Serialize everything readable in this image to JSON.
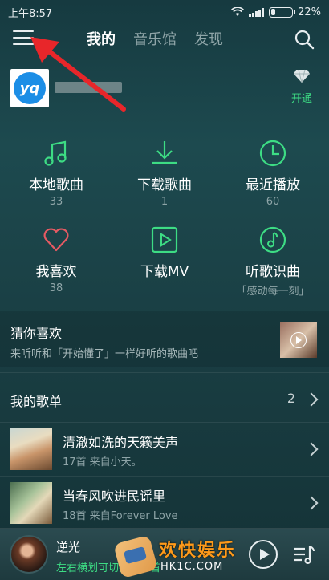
{
  "status_bar": {
    "time": "上午8:57",
    "battery": "22%",
    "battery_level": 0.22
  },
  "nav": {
    "tabs": [
      {
        "label": "我的",
        "active": true
      },
      {
        "label": "音乐馆",
        "active": false
      },
      {
        "label": "发现",
        "active": false
      }
    ]
  },
  "profile": {
    "avatar_text": "yq",
    "vip_label": "开通",
    "vip_icon": "diamond-icon"
  },
  "grid": [
    {
      "icon": "music-note-icon",
      "title": "本地歌曲",
      "sub": "33"
    },
    {
      "icon": "download-icon",
      "title": "下载歌曲",
      "sub": "1"
    },
    {
      "icon": "clock-icon",
      "title": "最近播放",
      "sub": "60"
    },
    {
      "icon": "heart-icon",
      "title": "我喜欢",
      "sub": "38"
    },
    {
      "icon": "video-play-icon",
      "title": "下载MV",
      "sub": ""
    },
    {
      "icon": "recognize-icon",
      "title": "听歌识曲",
      "sub": "「感动每一刻」"
    }
  ],
  "guess": {
    "title": "猜你喜欢",
    "subtitle": "来听听和「开始懂了」一样好听的歌曲吧"
  },
  "my_playlists": {
    "title": "我的歌单",
    "count": "2",
    "items": [
      {
        "name": "清澈如洗的天籁美声",
        "meta": "17首 来自小天。"
      },
      {
        "name": "当春风吹进民谣里",
        "meta": "18首 来自Forever Love"
      }
    ]
  },
  "player": {
    "song": "逆光",
    "hint": "左右横划可切换上下首"
  },
  "watermark": {
    "text": "欢快娱乐",
    "sub": "HK1C.COM"
  },
  "colors": {
    "accent": "#3ddc84",
    "annotation": "#e8262a",
    "background": "#1a3f44"
  }
}
